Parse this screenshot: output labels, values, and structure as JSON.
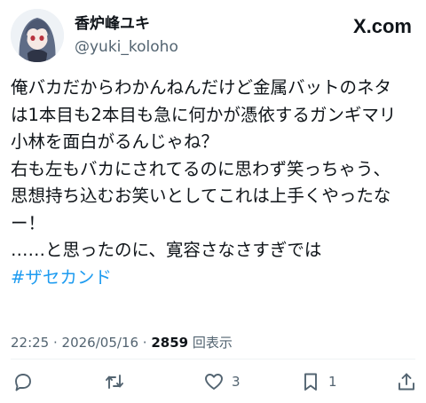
{
  "author": {
    "display_name": "香炉峰ユキ",
    "handle": "@yuki_koloho"
  },
  "brand": {
    "site_label": "X.com"
  },
  "tweet": {
    "lines": [
      "俺バカだからわかんねんだけど金属バットのネタ",
      "は1本目も2本目も急に何かが憑依するガンギマリ",
      "小林を面白がるんじゃね？",
      "右も左もバカにされてるのに思わず笑っちゃう、",
      "思想持ち込むお笑いとしてこれは上手くやったな",
      "ー！",
      "……と思ったのに、寛容さなさすぎでは"
    ],
    "hashtag": "#ザセカンド"
  },
  "meta": {
    "time": "22:25",
    "separator1": " · ",
    "date": "2026/05/16",
    "separator2": " · ",
    "views_count": "2859",
    "views_label": " 回表示"
  },
  "actions": {
    "reply": {
      "icon": "reply-icon",
      "count": ""
    },
    "repost": {
      "icon": "repost-icon",
      "count": ""
    },
    "like": {
      "icon": "like-icon",
      "count": "3"
    },
    "bookmark": {
      "icon": "bookmark-icon",
      "count": "1"
    },
    "share": {
      "icon": "share-icon",
      "count": ""
    }
  },
  "colors": {
    "text": "#0f1419",
    "secondary": "#536471",
    "link": "#1d9bf0",
    "background": "#ffffff"
  }
}
